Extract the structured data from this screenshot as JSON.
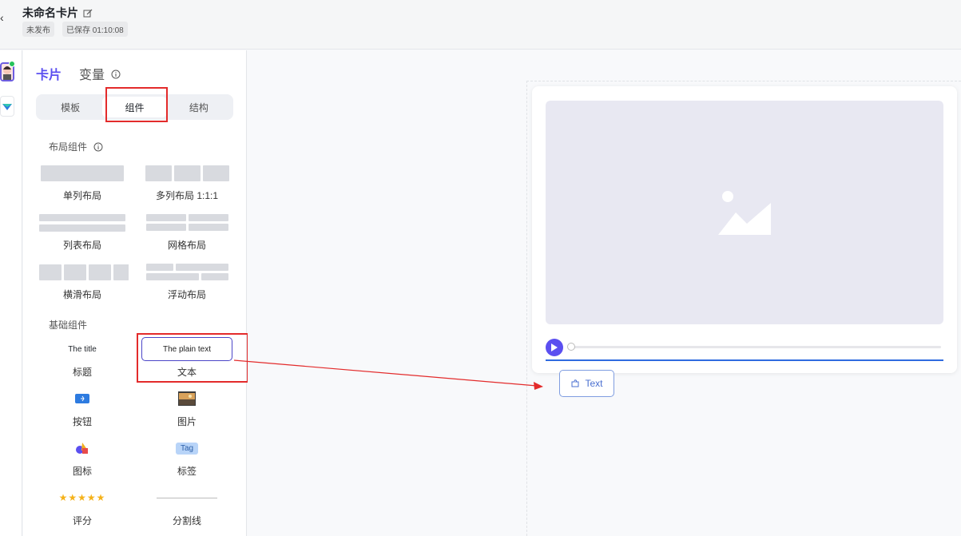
{
  "header": {
    "back": "‹",
    "title": "未命名卡片",
    "status": "未发布",
    "saved": "已保存 01:10:08"
  },
  "panel": {
    "tabs": [
      "卡片",
      "变量"
    ],
    "segments": [
      "模板",
      "组件",
      "结构"
    ],
    "layout_section": "布局组件",
    "layout_items": [
      "单列布局",
      "多列布局 1:1:1",
      "列表布局",
      "网格布局",
      "横滑布局",
      "浮动布局"
    ],
    "basic_section": "基础组件",
    "basic_items": {
      "title_preview": "The title",
      "title_label": "标题",
      "text_preview": "The plain text",
      "text_label": "文本",
      "button_label": "按钮",
      "image_label": "图片",
      "icon_label": "图标",
      "tag_preview": "Tag",
      "tag_label": "标签",
      "rating_stars": "★★★★★",
      "rating_label": "评分",
      "divider_label": "分割线"
    }
  },
  "canvas": {
    "drag_chip": "Text"
  },
  "colors": {
    "accent": "#5b4ff0",
    "highlight": "#e32b2b",
    "link_blue": "#2f6be0"
  }
}
